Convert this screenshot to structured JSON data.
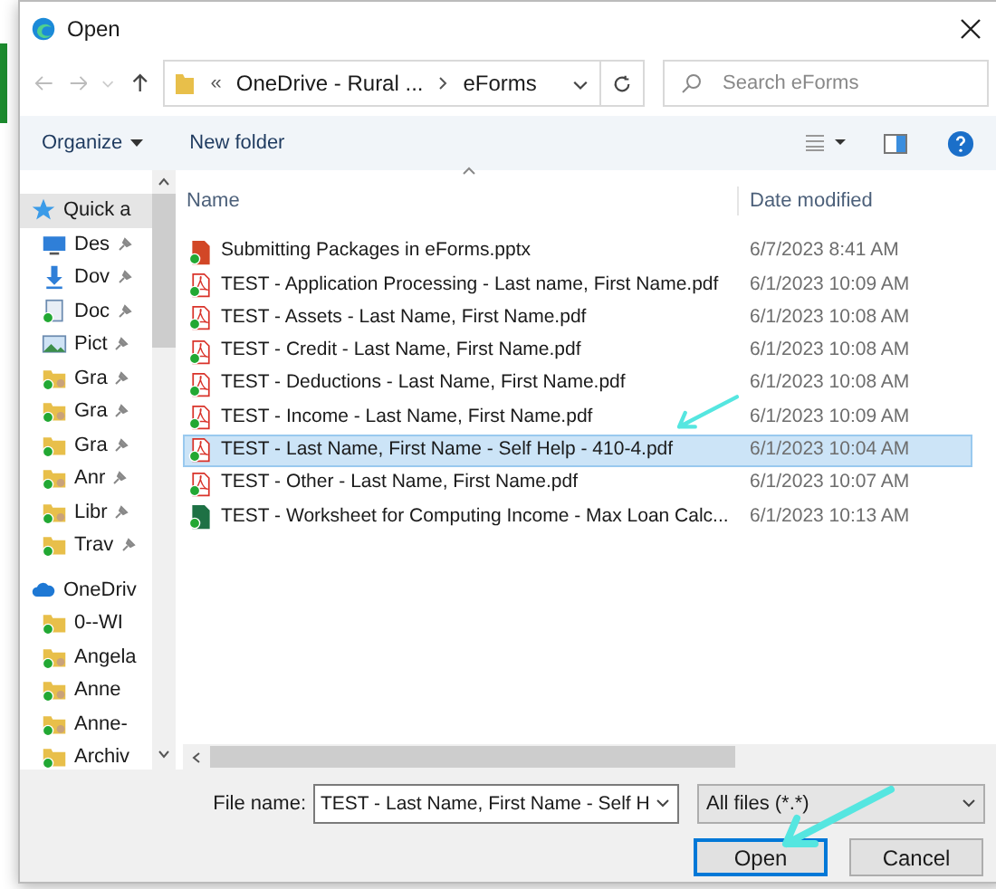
{
  "window": {
    "title": "Open"
  },
  "address": {
    "crumbs": [
      "OneDrive - Rural ...",
      "eForms"
    ],
    "overflow": "«"
  },
  "search": {
    "placeholder": "Search eForms"
  },
  "toolbar": {
    "organize": "Organize",
    "new_folder": "New folder"
  },
  "sidebar": {
    "items": [
      {
        "label": "Quick a",
        "kind": "star",
        "pinned": false,
        "selected": true
      },
      {
        "label": "Des",
        "kind": "desktop",
        "pinned": true,
        "selected": false
      },
      {
        "label": "Dov",
        "kind": "download",
        "pinned": true,
        "selected": false
      },
      {
        "label": "Doc",
        "kind": "document",
        "pinned": true,
        "selected": false
      },
      {
        "label": "Pict",
        "kind": "pictures",
        "pinned": true,
        "selected": false
      },
      {
        "label": "Gra",
        "kind": "shared",
        "pinned": true,
        "selected": false
      },
      {
        "label": "Gra",
        "kind": "shared",
        "pinned": true,
        "selected": false
      },
      {
        "label": "Gra",
        "kind": "folder",
        "pinned": true,
        "selected": false
      },
      {
        "label": "Anr",
        "kind": "shared",
        "pinned": true,
        "selected": false
      },
      {
        "label": "Libr",
        "kind": "shared",
        "pinned": true,
        "selected": false
      },
      {
        "label": "Trav",
        "kind": "folder",
        "pinned": true,
        "selected": false
      },
      {
        "label": "OneDriv",
        "kind": "cloud",
        "pinned": false,
        "selected": false
      },
      {
        "label": "0--WI",
        "kind": "folder",
        "pinned": false,
        "selected": false
      },
      {
        "label": "Angela",
        "kind": "shared",
        "pinned": false,
        "selected": false
      },
      {
        "label": "Anne",
        "kind": "shared",
        "pinned": false,
        "selected": false
      },
      {
        "label": "Anne-",
        "kind": "shared",
        "pinned": false,
        "selected": false
      },
      {
        "label": "Archiv",
        "kind": "folder",
        "pinned": false,
        "selected": false
      }
    ]
  },
  "file_list": {
    "columns": [
      "Name",
      "Date modified"
    ],
    "rows": [
      {
        "name": "Submitting Packages in eForms.pptx",
        "date": "6/7/2023 8:41 AM",
        "kind": "pptx",
        "selected": false
      },
      {
        "name": "TEST - Application Processing - Last name, First Name.pdf",
        "date": "6/1/2023 10:09 AM",
        "kind": "pdf",
        "selected": false
      },
      {
        "name": "TEST - Assets - Last Name, First Name.pdf",
        "date": "6/1/2023 10:08 AM",
        "kind": "pdf",
        "selected": false
      },
      {
        "name": "TEST - Credit - Last Name, First Name.pdf",
        "date": "6/1/2023 10:08 AM",
        "kind": "pdf",
        "selected": false
      },
      {
        "name": "TEST - Deductions - Last Name, First Name.pdf",
        "date": "6/1/2023 10:08 AM",
        "kind": "pdf",
        "selected": false
      },
      {
        "name": "TEST - Income - Last Name, First Name.pdf",
        "date": "6/1/2023 10:09 AM",
        "kind": "pdf",
        "selected": false
      },
      {
        "name": "TEST - Last Name, First Name - Self Help - 410-4.pdf",
        "date": "6/1/2023 10:04 AM",
        "kind": "pdf",
        "selected": true
      },
      {
        "name": "TEST - Other - Last Name, First Name.pdf",
        "date": "6/1/2023 10:07 AM",
        "kind": "pdf",
        "selected": false
      },
      {
        "name": "TEST - Worksheet for Computing Income - Max Loan Calc...",
        "date": "6/1/2023 10:13 AM",
        "kind": "xlsx",
        "selected": false
      }
    ]
  },
  "footer": {
    "file_name_label": "File name:",
    "file_name": "TEST - Last Name, First Name - Self H",
    "file_type": "All files (*.*)",
    "open": "Open",
    "cancel": "Cancel"
  }
}
